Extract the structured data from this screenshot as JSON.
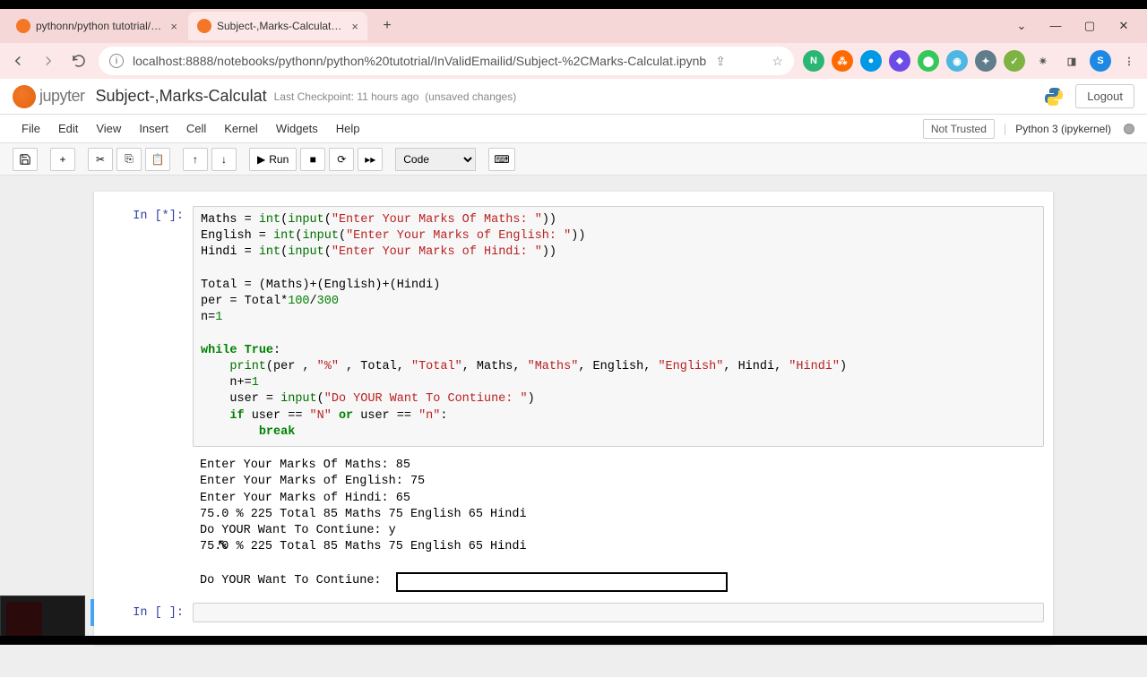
{
  "browser": {
    "tabs": [
      {
        "title": "pythonn/python tutotrial/InValid",
        "favicon_color": "#f37726"
      },
      {
        "title": "Subject-,Marks-Calculat - Jupyte",
        "favicon_color": "#f37726"
      }
    ],
    "url": "localhost:8888/notebooks/pythonn/python%20tutotrial/InValidEmailid/Subject-%2CMarks-Calculat.ipynb",
    "extension_colors": [
      "#2bb673",
      "#ff6a00",
      "#0099e5",
      "#6b4ce6",
      "#34c759",
      "#9c27b0",
      "#607d8b",
      "#ffb300",
      "#4caf50"
    ],
    "avatar_letter": "S",
    "avatar_color": "#1e88e5"
  },
  "jupyter": {
    "logo_text": "jupyter",
    "title": "Subject-,Marks-Calculat",
    "checkpoint": "Last Checkpoint: 11 hours ago",
    "unsaved": "(unsaved changes)",
    "logout": "Logout",
    "trusted": "Not Trusted",
    "kernel": "Python 3 (ipykernel)",
    "menus": [
      "File",
      "Edit",
      "View",
      "Insert",
      "Cell",
      "Kernel",
      "Widgets",
      "Help"
    ],
    "run_label": "Run",
    "cell_type": "Code"
  },
  "code": {
    "prompt": "In [*]:",
    "l1a": "Maths = ",
    "l1b": "int",
    "l1c": "(",
    "l1d": "input",
    "l1e": "(",
    "l1f": "\"Enter Your Marks Of Maths: \"",
    "l1g": "))",
    "l2a": "English = ",
    "l2b": "int",
    "l2c": "(",
    "l2d": "input",
    "l2e": "(",
    "l2f": "\"Enter Your Marks of English: \"",
    "l2g": "))",
    "l3a": "Hindi = ",
    "l3b": "int",
    "l3c": "(",
    "l3d": "input",
    "l3e": "(",
    "l3f": "\"Enter Your Marks of Hindi: \"",
    "l3g": "))",
    "blank": "",
    "l4": "Total = (Maths)+(English)+(Hindi)",
    "l5a": "per = Total*",
    "l5b": "100",
    "l5c": "/",
    "l5d": "300",
    "l6a": "n=",
    "l6b": "1",
    "l7a": "while",
    "l7b": " ",
    "l7c": "True",
    "l7d": ":",
    "l8a": "    ",
    "l8b": "print",
    "l8c": "(per , ",
    "l8d": "\"%\"",
    "l8e": " , Total, ",
    "l8f": "\"Total\"",
    "l8g": ", Maths, ",
    "l8h": "\"Maths\"",
    "l8i": ", English, ",
    "l8j": "\"English\"",
    "l8k": ", Hindi, ",
    "l8l": "\"Hindi\"",
    "l8m": ")",
    "l9a": "    n+=",
    "l9b": "1",
    "l10a": "    user = ",
    "l10b": "input",
    "l10c": "(",
    "l10d": "\"Do YOUR Want To Contiune: \"",
    "l10e": ")",
    "l11a": "    ",
    "l11b": "if",
    "l11c": " user == ",
    "l11d": "\"N\"",
    "l11e": " ",
    "l11f": "or",
    "l11g": " user == ",
    "l11h": "\"n\"",
    "l11i": ":",
    "l12a": "        ",
    "l12b": "break"
  },
  "output": {
    "lines": "Enter Your Marks Of Maths: 85\nEnter Your Marks of English: 75\nEnter Your Marks of Hindi: 65\n75.0 % 225 Total 85 Maths 75 English 65 Hindi\nDo YOUR Want To Contiune: y\n75.0 % 225 Total 85 Maths 75 English 65 Hindi",
    "input_prompt": "Do YOUR Want To Contiune: "
  },
  "empty_cell": {
    "prompt": "In [ ]:"
  }
}
